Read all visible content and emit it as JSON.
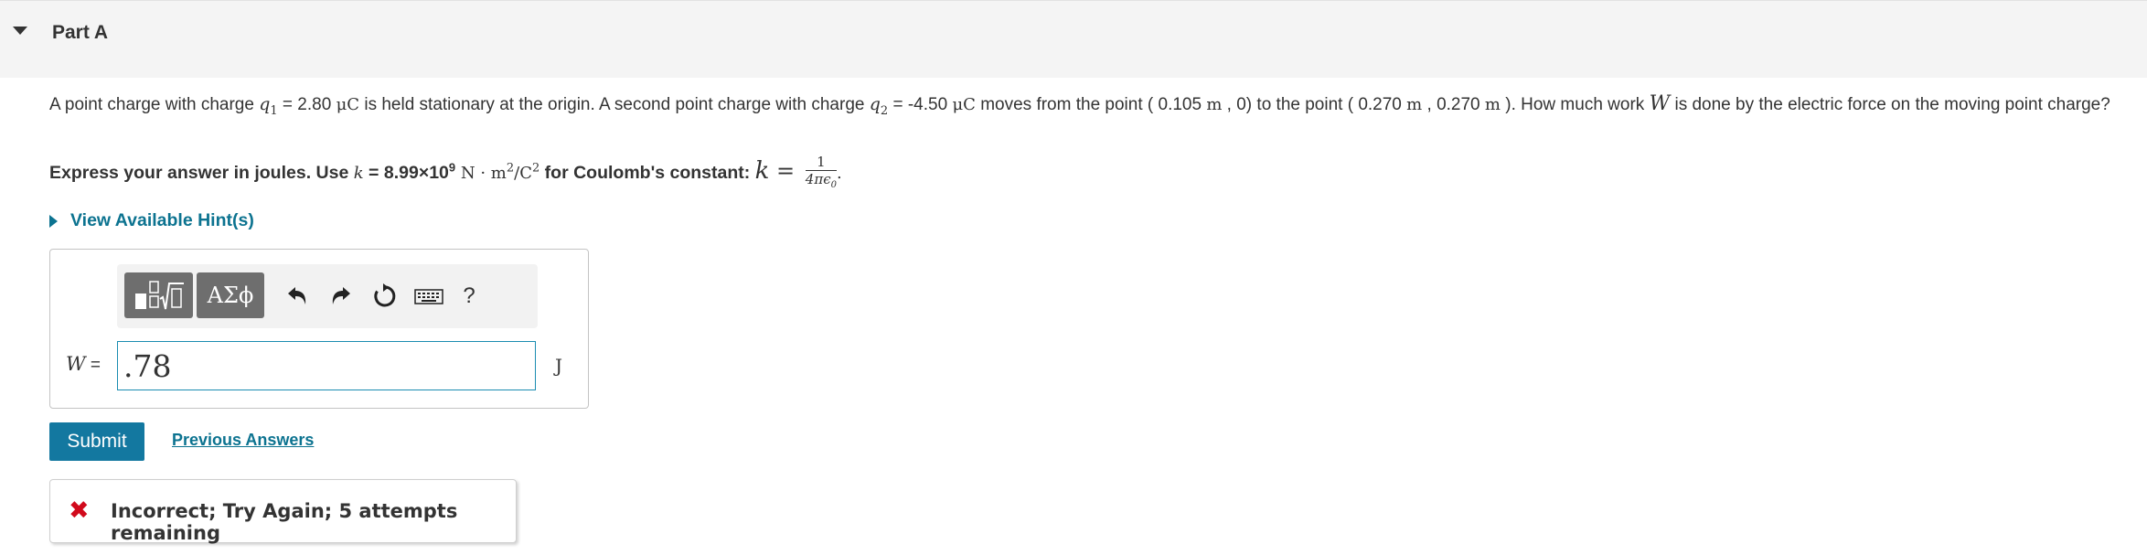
{
  "part": {
    "title": "Part A"
  },
  "problem": {
    "intro": "A point charge with charge ",
    "q1_sym": "q",
    "q1_sub": "1",
    "eq1": " = 2.80 ",
    "unit_uC_1": "μC",
    "mid1": " is held stationary at the origin. A second point charge with charge ",
    "q2_sym": "q",
    "q2_sub": "2",
    "eq2": " = -4.50 ",
    "unit_uC_2": "μC",
    "mid2": " moves from the point ( 0.105 ",
    "m1": "m",
    "mid3": " , 0) to the point ( 0.270 ",
    "m2": "m",
    "mid4": " , 0.270 ",
    "m3": "m",
    "mid5": " ). How much work ",
    "w_sym": "W",
    "end": " is done by the electric force on the moving point charge?"
  },
  "instruction": {
    "lead": "Express your answer in joules. Use ",
    "k_sym": "k",
    "k_val": " = 8.99×10",
    "exp": "9",
    "units_a": " N · m",
    "units_exp1": "2",
    "units_b": "/C",
    "units_exp2": "2",
    "tail": " for Coulomb's constant: ",
    "k_big": "k",
    "equals": " = ",
    "frac_num": "1",
    "frac_den": "4πϵ",
    "frac_den_sub": "0",
    "period": "."
  },
  "hint": {
    "label": "View Available Hint(s)"
  },
  "toolbar": {
    "templates_icon": "templates-icon",
    "greek_label": "ΑΣϕ",
    "undo_icon": "undo-icon",
    "redo_icon": "redo-icon",
    "reset_icon": "reset-icon",
    "keyboard_icon": "keyboard-icon",
    "help_label": "?"
  },
  "answer": {
    "variable": "W",
    "equals": " =",
    "value": ".78",
    "unit": "J"
  },
  "actions": {
    "submit_label": "Submit",
    "previous_label": "Previous Answers"
  },
  "feedback": {
    "icon": "incorrect-x-icon",
    "text": "Incorrect; Try Again; 5 attempts remaining"
  },
  "colors": {
    "link": "#0c7390",
    "submit_bg": "#1378a0",
    "error": "#d10a1c",
    "input_border": "#1a8cb1"
  }
}
